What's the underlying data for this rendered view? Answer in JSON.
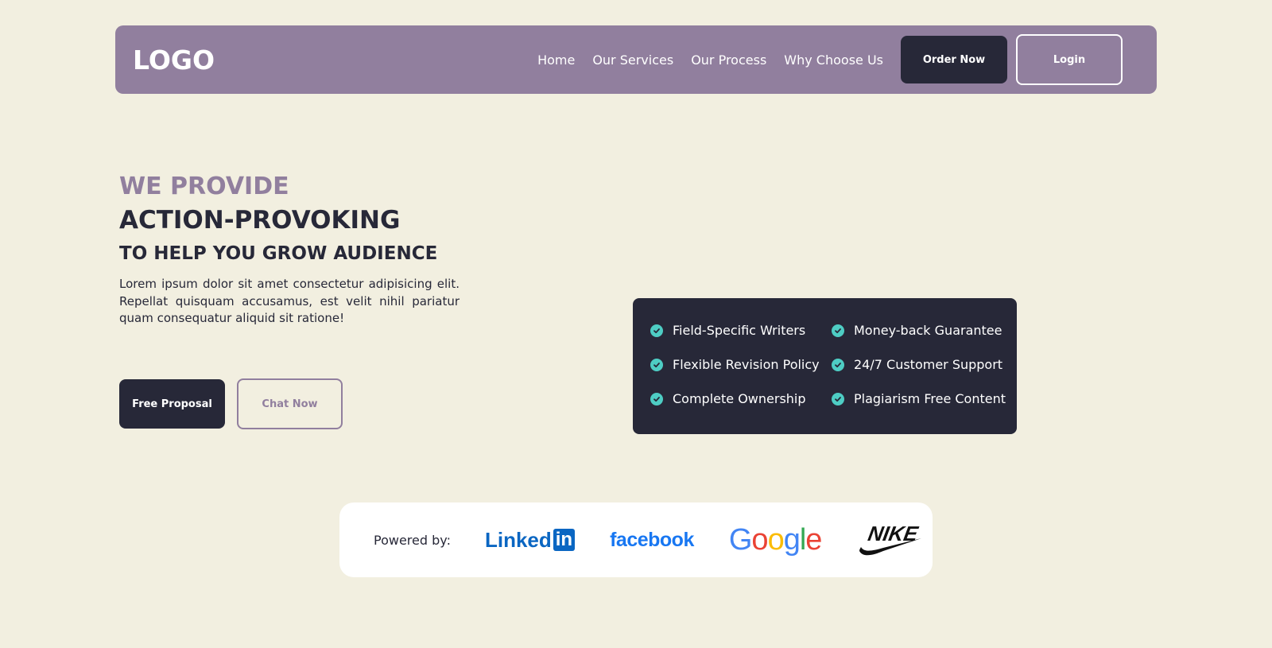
{
  "header": {
    "logo": "LOGO",
    "nav": [
      "Home",
      "Our Services",
      "Our Process",
      "Why Choose Us"
    ],
    "order_label": "Order Now",
    "login_label": "Login"
  },
  "hero": {
    "line1": "WE PROVIDE",
    "line2": "ACTION-PROVOKING",
    "line3": "TO HELP YOU GROW AUDIENCE",
    "description": "Lorem ipsum dolor sit amet consectetur adipisicing elit. Repellat quisquam accusamus, est velit nihil pariatur quam consequatur aliquid sit ratione!",
    "primary_label": "Free Proposal",
    "secondary_label": "Chat Now"
  },
  "features": [
    "Field-Specific Writers",
    "Money-back Guarantee",
    "Flexible Revision Policy",
    "24/7 Customer Support",
    "Complete Ownership",
    "Plagiarism Free Content"
  ],
  "powered_by": {
    "label": "Powered by:",
    "brands": {
      "linkedin": "Linked",
      "linkedin_in": "in",
      "facebook": "facebook",
      "google": [
        "G",
        "o",
        "o",
        "g",
        "l",
        "e"
      ],
      "nike": "NIKE"
    }
  },
  "colors": {
    "background": "#f2efe0",
    "accent": "#917f9e",
    "dark": "#272838",
    "check": "#4ecdc4"
  },
  "icons": {
    "feature_bullet": "check-circle-icon"
  }
}
